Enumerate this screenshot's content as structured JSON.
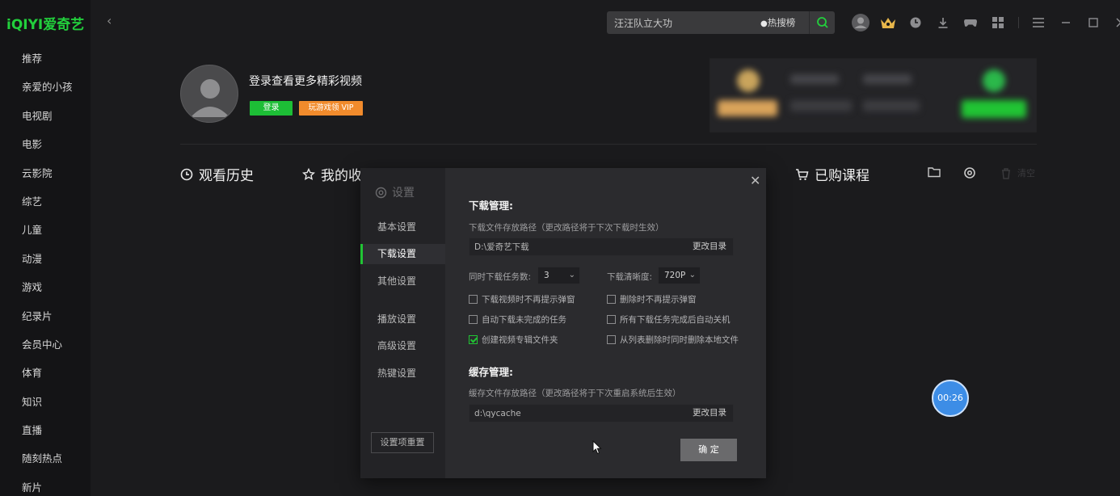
{
  "app": {
    "logo": "iQIYI爱奇艺",
    "brand_color": "#22cf3c"
  },
  "sidebar": {
    "items": [
      {
        "label": "推荐"
      },
      {
        "label": "亲爱的小孩"
      },
      {
        "label": "电视剧"
      },
      {
        "label": "电影"
      },
      {
        "label": "云影院"
      },
      {
        "label": "综艺"
      },
      {
        "label": "儿童"
      },
      {
        "label": "动漫"
      },
      {
        "label": "游戏"
      },
      {
        "label": "纪录片"
      },
      {
        "label": "会员中心"
      },
      {
        "label": "体育"
      },
      {
        "label": "知识"
      },
      {
        "label": "直播"
      },
      {
        "label": "随刻热点"
      },
      {
        "label": "新片"
      }
    ]
  },
  "search": {
    "value": "汪汪队立大功",
    "hot_label": "热搜榜"
  },
  "profile": {
    "prompt": "登录查看更多精彩视频",
    "login_label": "登录",
    "vip_label": "玩游戏领 VIP"
  },
  "sections": {
    "history": "观看历史",
    "favorites": "我的收",
    "courses": "已购课程",
    "clear": "清空"
  },
  "settings": {
    "title": "设置",
    "nav": [
      {
        "label": "基本设置"
      },
      {
        "label": "下载设置"
      },
      {
        "label": "其他设置"
      },
      {
        "label": "播放设置"
      },
      {
        "label": "高级设置"
      },
      {
        "label": "热键设置"
      }
    ],
    "active_nav": "下载设置",
    "reset_label": "设置项重置",
    "download": {
      "heading": "下载管理:",
      "path_desc": "下载文件存放路径（更改路径将于下次下载时生效）",
      "path_value": "D:\\爱奇艺下载",
      "change_label": "更改目录",
      "concurrent_label": "同时下载任务数:",
      "concurrent_value": "3",
      "quality_label": "下载清晰度:",
      "quality_value": "720P",
      "options": [
        {
          "label": "下载视频时不再提示弹窗",
          "checked": false
        },
        {
          "label": "删除时不再提示弹窗",
          "checked": false
        },
        {
          "label": "自动下载未完成的任务",
          "checked": false
        },
        {
          "label": "所有下载任务完成后自动关机",
          "checked": false
        },
        {
          "label": "创建视频专辑文件夹",
          "checked": true
        },
        {
          "label": "从列表删除时同时删除本地文件",
          "checked": false
        }
      ]
    },
    "cache": {
      "heading": "缓存管理:",
      "path_desc": "缓存文件存放路径（更改路径将于下次重启系统后生效）",
      "path_value": "d:\\qycache",
      "change_label": "更改目录"
    },
    "ok_label": "确 定"
  },
  "timer": "00:26"
}
